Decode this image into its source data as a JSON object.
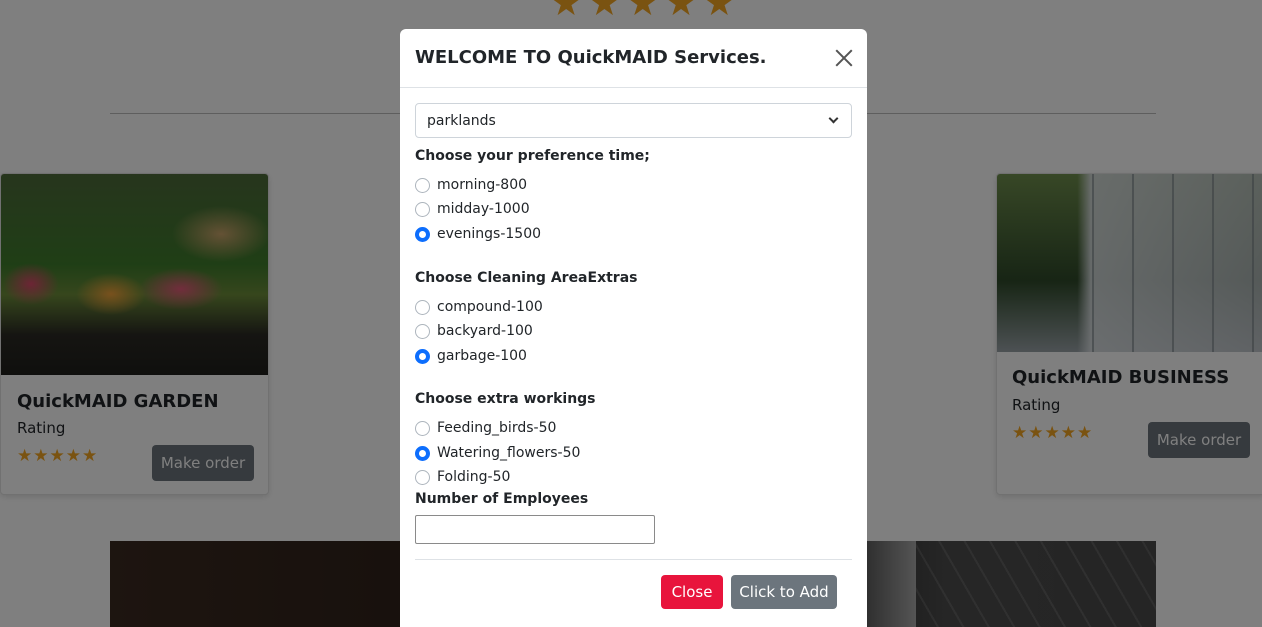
{
  "background": {
    "top_stars": [
      "★",
      "★",
      "★",
      "★",
      "★"
    ],
    "cards": {
      "garden": {
        "title": "QuickMAID GARDEN",
        "rating_label": "Rating",
        "rating": 5,
        "button": "Make order"
      },
      "business": {
        "title": "QuickMAID BUSINESS",
        "rating_label": "Rating",
        "rating": 5,
        "button": "Make order"
      }
    }
  },
  "modal": {
    "title": "WELCOME TO QuickMAID Services.",
    "location_select": {
      "value": "parklands"
    },
    "time_section": {
      "label": "Choose your preference time;",
      "options": [
        {
          "label": "morning-800",
          "checked": false
        },
        {
          "label": "midday-1000",
          "checked": false
        },
        {
          "label": "evenings-1500",
          "checked": true
        }
      ]
    },
    "area_section": {
      "label": "Choose Cleaning AreaExtras",
      "options": [
        {
          "label": "compound-100",
          "checked": false
        },
        {
          "label": "backyard-100",
          "checked": false
        },
        {
          "label": "garbage-100",
          "checked": true
        }
      ]
    },
    "extra_section": {
      "label": "Choose extra workings",
      "options": [
        {
          "label": "Feeding_birds-50",
          "checked": false
        },
        {
          "label": "Watering_flowers-50",
          "checked": true
        },
        {
          "label": "Folding-50",
          "checked": false
        }
      ]
    },
    "employees": {
      "label": "Number of Employees",
      "value": ""
    },
    "buttons": {
      "close": "Close",
      "add": "Click to Add"
    }
  },
  "colors": {
    "accent_radio": "#0d6efd",
    "close_button": "#e8143c",
    "secondary_button": "#6c757d",
    "star": "#f5a623"
  }
}
